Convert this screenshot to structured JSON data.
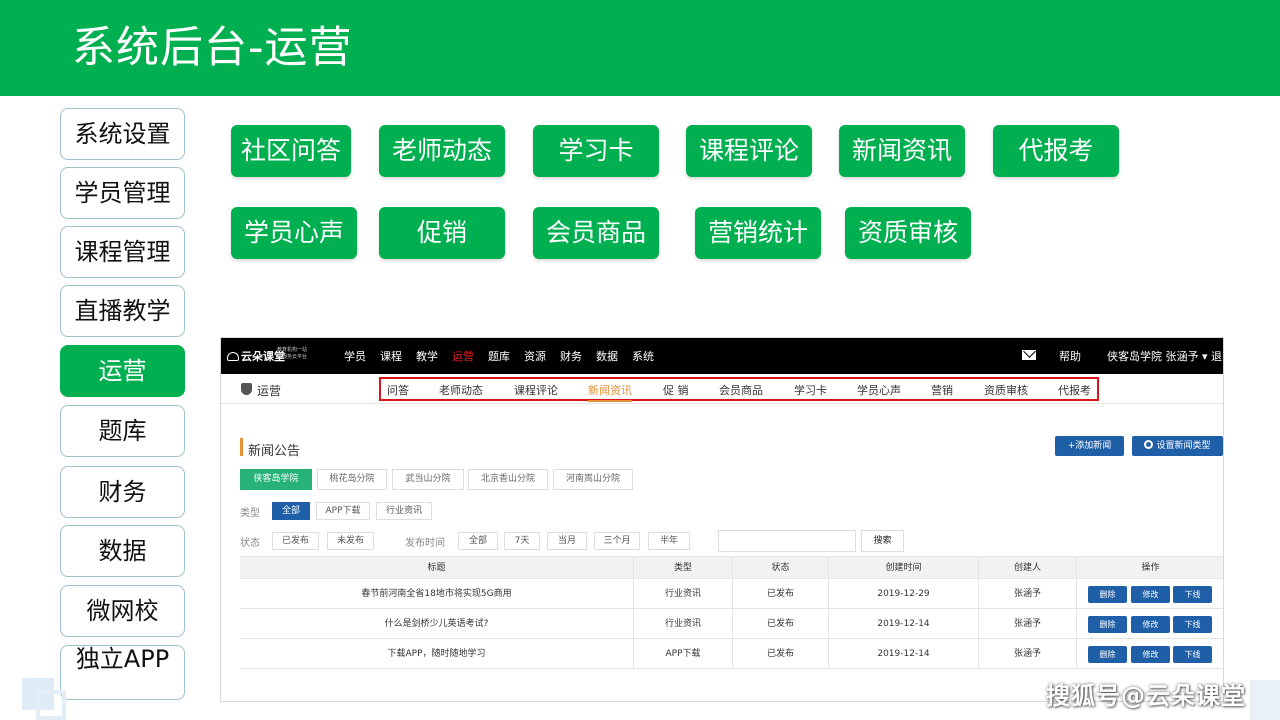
{
  "slide": {
    "title": "系统后台-运营",
    "accent_color": "#00b050"
  },
  "sidebar": {
    "items": [
      {
        "label": "系统设置",
        "active": false
      },
      {
        "label": "学员管理",
        "active": false
      },
      {
        "label": "课程管理",
        "active": false
      },
      {
        "label": "直播教学",
        "active": false
      },
      {
        "label": "运营",
        "active": true
      },
      {
        "label": "题库",
        "active": false
      },
      {
        "label": "财务",
        "active": false
      },
      {
        "label": "数据",
        "active": false
      },
      {
        "label": "微网校",
        "active": false
      },
      {
        "label": "独立APP",
        "active": false
      }
    ]
  },
  "features": {
    "row1": [
      "社区问答",
      "老师动态",
      "学习卡",
      "课程评论",
      "新闻资讯",
      "代报考"
    ],
    "row2": [
      "学员心声",
      "促销",
      "会员商品",
      "营销统计",
      "资质审核"
    ]
  },
  "screenshot": {
    "logo": "云朵课堂",
    "logo_sub": "教育机构一站式服务云平台",
    "top_nav": [
      {
        "label": "学员",
        "current": false
      },
      {
        "label": "课程",
        "current": false
      },
      {
        "label": "教学",
        "current": false
      },
      {
        "label": "运营",
        "current": true
      },
      {
        "label": "题库",
        "current": false
      },
      {
        "label": "资源",
        "current": false
      },
      {
        "label": "财务",
        "current": false
      },
      {
        "label": "数据",
        "current": false
      },
      {
        "label": "系统",
        "current": false
      }
    ],
    "help": "帮助",
    "user": "侠客岛学院 张涵予 ▾ 退",
    "section_name": "运营",
    "sub_nav": [
      {
        "label": "问答",
        "current": false
      },
      {
        "label": "老师动态",
        "current": false
      },
      {
        "label": "课程评论",
        "current": false
      },
      {
        "label": "新闻资讯",
        "current": true
      },
      {
        "label": "促 销",
        "current": false
      },
      {
        "label": "会员商品",
        "current": false
      },
      {
        "label": "学习卡",
        "current": false
      },
      {
        "label": "学员心声",
        "current": false
      },
      {
        "label": "营销",
        "current": false
      },
      {
        "label": "资质审核",
        "current": false
      },
      {
        "label": "代报考",
        "current": false
      }
    ],
    "panel_title": "新闻公告",
    "add_button": "+添加新闻",
    "settings_button": "设置新闻类型",
    "branch_tabs": [
      {
        "label": "侠客岛学院",
        "active": true
      },
      {
        "label": "桃花岛分院",
        "active": false
      },
      {
        "label": "武当山分院",
        "active": false
      },
      {
        "label": "北京香山分院",
        "active": false
      },
      {
        "label": "河南嵩山分院",
        "active": false
      }
    ],
    "filters": {
      "type_label": "类型",
      "type_options": [
        {
          "label": "全部",
          "active": true
        },
        {
          "label": "APP下载",
          "active": false
        },
        {
          "label": "行业资讯",
          "active": false
        }
      ],
      "status_label": "状态",
      "status_options": [
        "已发布",
        "未发布"
      ],
      "time_label": "发布时间",
      "time_options": [
        "全部",
        "7天",
        "当月",
        "三个月",
        "半年"
      ],
      "search_placeholder": "",
      "search_button": "搜索"
    },
    "table": {
      "headers": [
        "标题",
        "类型",
        "状态",
        "创建时间",
        "创建人",
        "操作"
      ],
      "rows": [
        {
          "title": "春节前河南全省18地市将实现5G商用",
          "type": "行业资讯",
          "status": "已发布",
          "created": "2019-12-29",
          "creator": "张涵予"
        },
        {
          "title": "什么是剑桥少儿英语考试?",
          "type": "行业资讯",
          "status": "已发布",
          "created": "2019-12-14",
          "creator": "张涵予"
        },
        {
          "title": "下载APP，随时随地学习",
          "type": "APP下载",
          "status": "已发布",
          "created": "2019-12-14",
          "creator": "张涵予"
        }
      ],
      "actions": [
        "删除",
        "修改",
        "下线"
      ]
    }
  },
  "watermark": "搜狐号@云朵课堂"
}
